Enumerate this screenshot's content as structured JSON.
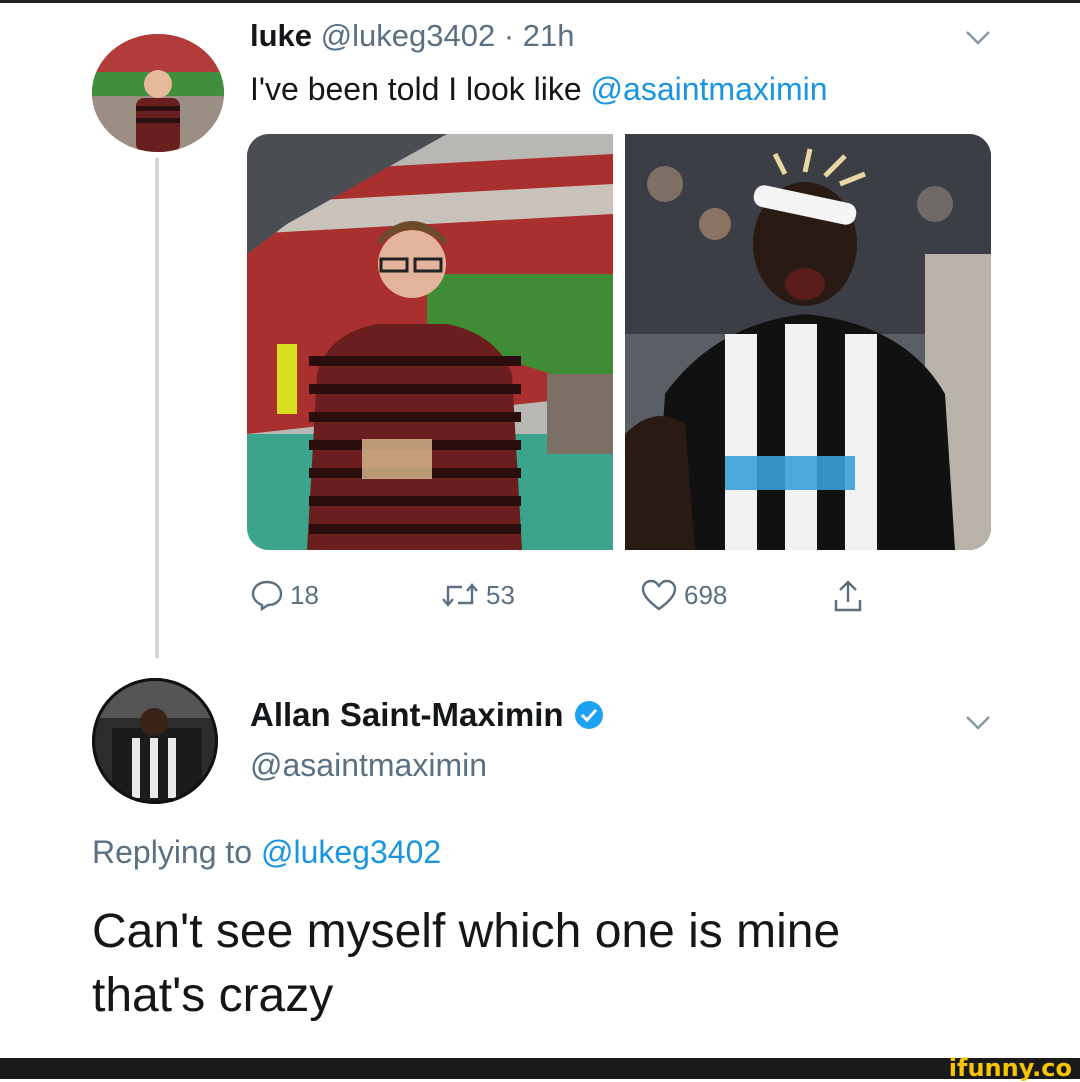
{
  "tweet": {
    "author_name": "luke",
    "author_handle": "@lukeg3402",
    "separator": "·",
    "time": "21h",
    "text_prefix": "I've been told I look like ",
    "text_mention": "@asaintmaximin",
    "stats": {
      "replies": "18",
      "retweets": "53",
      "likes": "698"
    }
  },
  "reply": {
    "author_name": "Allan Saint-Maximin",
    "author_handle": "@asaintmaximin",
    "replying_prefix": "Replying to ",
    "replying_mention": "@lukeg3402",
    "text_line1": "Can't see myself which one is mine",
    "text_line2": "that's crazy"
  },
  "watermark": "ifunny.co",
  "colors": {
    "link": "#1b95e0",
    "secondary_text": "#5b7083",
    "verified": "#1da1f2",
    "watermark": "#f7c600"
  },
  "icons": [
    "chevron-down-icon",
    "reply-icon",
    "retweet-icon",
    "like-icon",
    "share-icon",
    "verified-badge-icon"
  ]
}
